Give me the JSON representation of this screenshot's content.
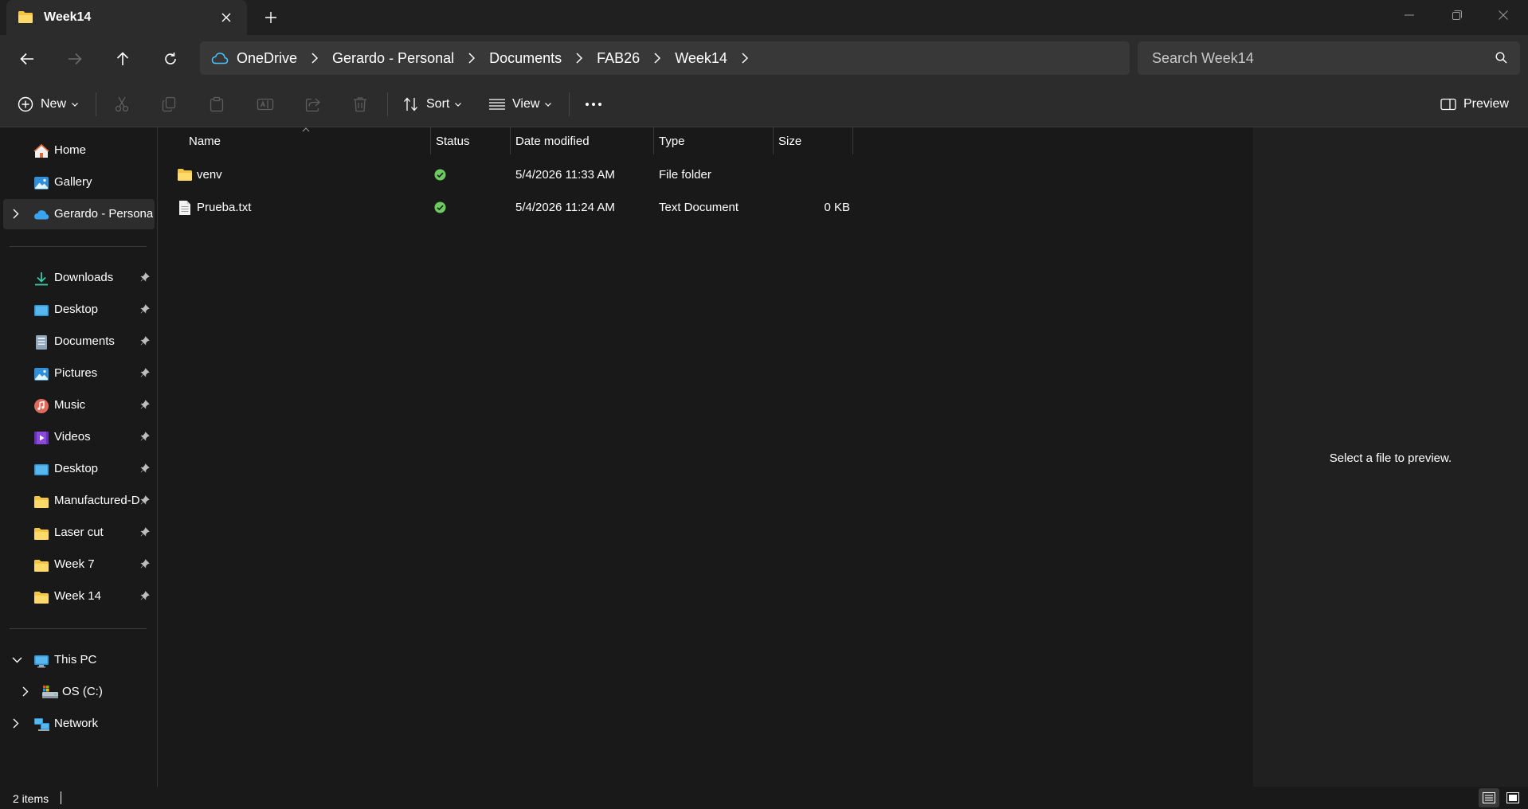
{
  "window": {
    "tab_title": "Week14",
    "tab_icon": "folder-icon"
  },
  "address": {
    "breadcrumbs": [
      "OneDrive",
      "Gerardo - Personal",
      "Documents",
      "FAB26",
      "Week14"
    ],
    "search_placeholder": "Search Week14"
  },
  "commands": {
    "new_label": "New",
    "sort_label": "Sort",
    "view_label": "View",
    "preview_label": "Preview"
  },
  "sidebar": {
    "top_items": [
      {
        "label": "Home",
        "icon": "home-icon"
      },
      {
        "label": "Gallery",
        "icon": "gallery-icon"
      },
      {
        "label": "Gerardo - Personal",
        "icon": "onedrive-cloud-icon"
      }
    ],
    "pinned_items": [
      {
        "label": "Downloads",
        "icon": "downloads-icon"
      },
      {
        "label": "Desktop",
        "icon": "desktop-icon"
      },
      {
        "label": "Documents",
        "icon": "documents-icon"
      },
      {
        "label": "Pictures",
        "icon": "pictures-icon"
      },
      {
        "label": "Music",
        "icon": "music-icon"
      },
      {
        "label": "Videos",
        "icon": "videos-icon"
      },
      {
        "label": "Desktop",
        "icon": "desktop-icon"
      },
      {
        "label": "Manufactured-D",
        "icon": "folder-icon"
      },
      {
        "label": "Laser cut",
        "icon": "folder-icon"
      },
      {
        "label": "Week 7",
        "icon": "folder-icon"
      },
      {
        "label": "Week 14",
        "icon": "folder-icon"
      }
    ],
    "bottom_items": [
      {
        "label": "This PC",
        "icon": "this-pc-icon"
      },
      {
        "label": "OS (C:)",
        "icon": "drive-icon"
      },
      {
        "label": "Network",
        "icon": "network-icon"
      }
    ]
  },
  "file_list": {
    "columns": [
      "Name",
      "Status",
      "Date modified",
      "Type",
      "Size"
    ],
    "rows": [
      {
        "name": "venv",
        "status": "synced",
        "date_modified": "5/4/2026 11:33 AM",
        "type": "File folder",
        "size": "",
        "icon": "folder-icon"
      },
      {
        "name": "Prueba.txt",
        "status": "synced",
        "date_modified": "5/4/2026 11:24 AM",
        "type": "Text Document",
        "size": "0 KB",
        "icon": "text-file-icon"
      }
    ]
  },
  "preview": {
    "message": "Select a file to preview."
  },
  "status_bar": {
    "item_count": "2 items"
  },
  "colors": {
    "background": "#191919",
    "chrome": "#2c2c2c",
    "folder": "#f4c542",
    "sync_ok": "#6ccb5f",
    "cloud": "#4cc2ff"
  }
}
